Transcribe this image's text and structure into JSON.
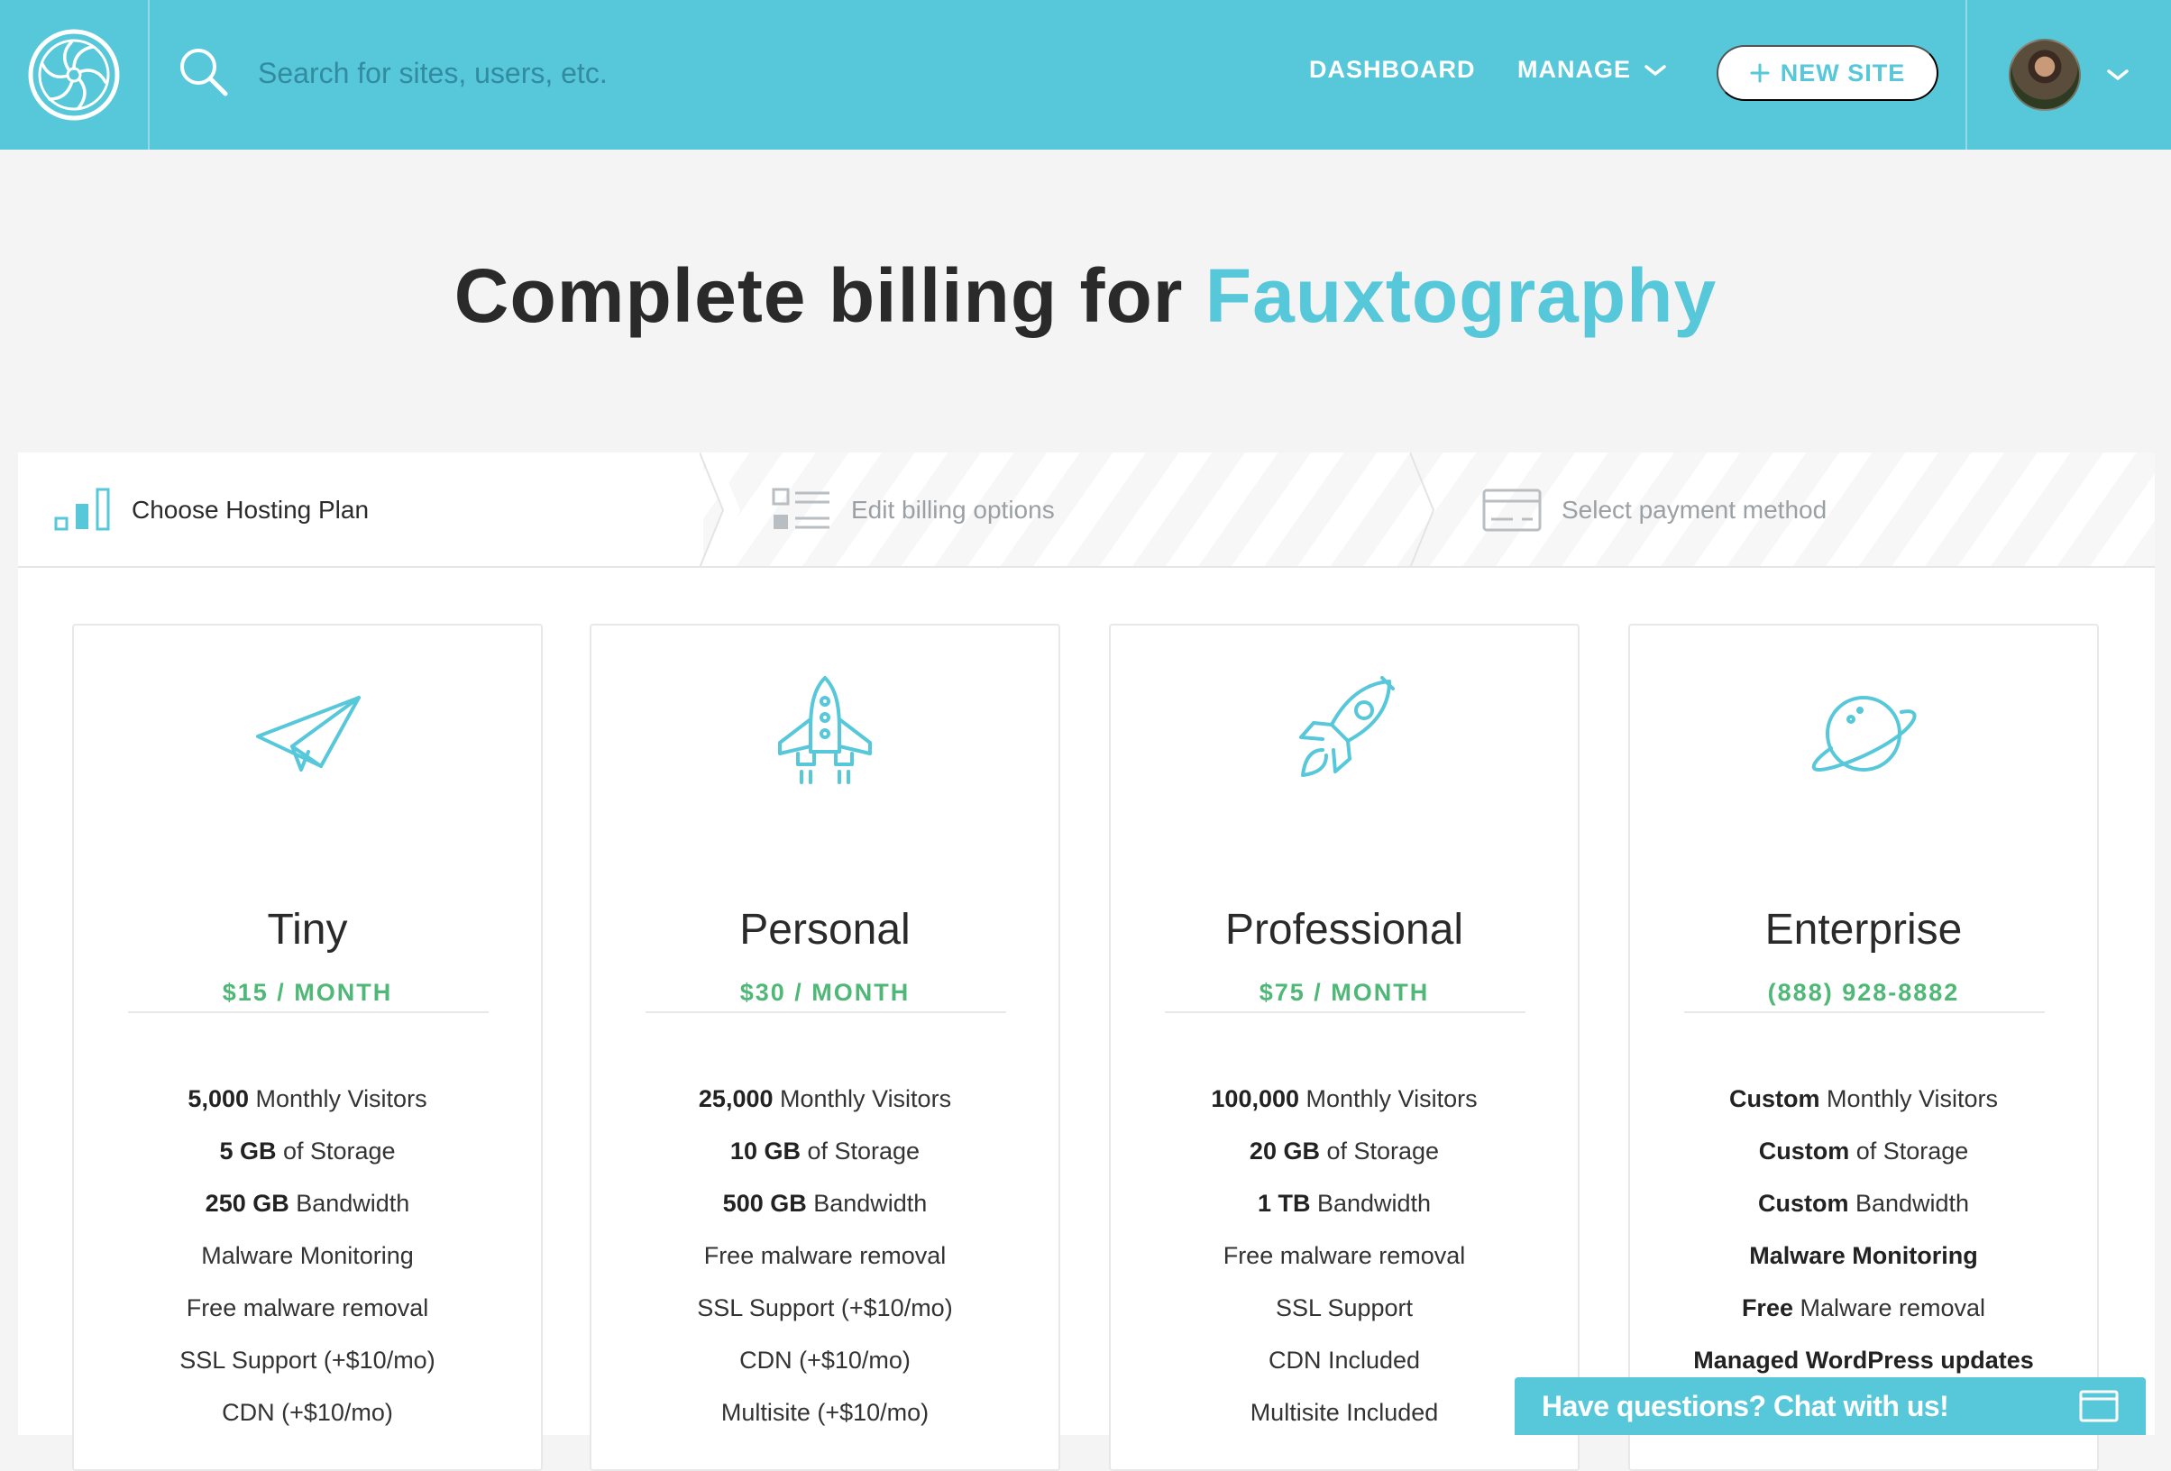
{
  "header": {
    "search_placeholder": "Search for sites, users, etc.",
    "nav": {
      "dashboard": "DASHBOARD",
      "manage": "MANAGE"
    },
    "new_site_label": "NEW SITE",
    "new_site_icon": "plus-icon",
    "colors": {
      "bar": "#57c7da"
    }
  },
  "title": {
    "prefix": "Complete billing for",
    "site_name": "Fauxtography"
  },
  "steps": [
    {
      "label": "Choose Hosting Plan",
      "icon": "bar-chart-icon",
      "active": true
    },
    {
      "label": "Edit billing options",
      "icon": "list-icon",
      "active": false
    },
    {
      "label": "Select payment method",
      "icon": "credit-card-icon",
      "active": false
    }
  ],
  "plans": [
    {
      "name": "Tiny",
      "price": "$15 / MONTH",
      "icon": "paper-plane-icon",
      "features": [
        {
          "bold": "5,000",
          "text": " Monthly Visitors"
        },
        {
          "bold": "5 GB",
          "text": " of Storage"
        },
        {
          "bold": "250 GB",
          "text": " Bandwidth"
        },
        {
          "bold": "",
          "text": "Malware Monitoring"
        },
        {
          "bold": "",
          "text": "Free malware removal"
        },
        {
          "bold": "",
          "text": "SSL Support (+$10/mo)"
        },
        {
          "bold": "",
          "text": "CDN (+$10/mo)"
        }
      ]
    },
    {
      "name": "Personal",
      "price": "$30 / MONTH",
      "icon": "shuttle-icon",
      "features": [
        {
          "bold": "25,000",
          "text": " Monthly Visitors"
        },
        {
          "bold": "10 GB",
          "text": " of Storage"
        },
        {
          "bold": "500 GB",
          "text": " Bandwidth"
        },
        {
          "bold": "",
          "text": "Free malware removal"
        },
        {
          "bold": "",
          "text": "SSL Support (+$10/mo)"
        },
        {
          "bold": "",
          "text": "CDN (+$10/mo)"
        },
        {
          "bold": "",
          "text": "Multisite (+$10/mo)"
        }
      ]
    },
    {
      "name": "Professional",
      "price": "$75 / MONTH",
      "icon": "rocket-icon",
      "features": [
        {
          "bold": "100,000",
          "text": " Monthly Visitors"
        },
        {
          "bold": "20 GB",
          "text": " of Storage"
        },
        {
          "bold": "1 TB",
          "text": " Bandwidth"
        },
        {
          "bold": "",
          "text": "Free malware removal"
        },
        {
          "bold": "",
          "text": "SSL Support"
        },
        {
          "bold": "",
          "text": "CDN Included"
        },
        {
          "bold": "",
          "text": "Multisite Included"
        }
      ]
    },
    {
      "name": "Enterprise",
      "price": "(888) 928-8882",
      "icon": "planet-icon",
      "features": [
        {
          "bold": "Custom",
          "text": " Monthly Visitors"
        },
        {
          "bold": "Custom",
          "text": " of Storage"
        },
        {
          "bold": "Custom",
          "text": " Bandwidth"
        },
        {
          "bold": "Malware Monitoring",
          "text": ""
        },
        {
          "bold": "Free",
          "text": " Malware removal"
        },
        {
          "bold": "Managed WordPress updates",
          "text": ""
        }
      ]
    }
  ],
  "chat": {
    "label": "Have questions? Chat with us!",
    "icon": "window-icon"
  },
  "colors": {
    "accent": "#57c7da",
    "price": "#4fb877"
  }
}
